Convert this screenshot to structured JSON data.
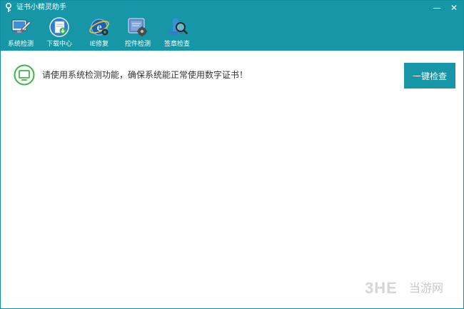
{
  "window": {
    "title": "证书小精灵助手",
    "minimize_glyph": "—",
    "close_glyph": "✕"
  },
  "toolbar": {
    "items": [
      {
        "label": "系统检测",
        "icon": "system-check-icon"
      },
      {
        "label": "下载中心",
        "icon": "download-center-icon"
      },
      {
        "label": "IE修复",
        "icon": "ie-repair-icon"
      },
      {
        "label": "控件检测",
        "icon": "control-check-icon"
      },
      {
        "label": "签章检查",
        "icon": "signature-check-icon"
      }
    ]
  },
  "main": {
    "notice": "请使用系统检测功能，确保系统能正常使用数字证书！",
    "check_button": "一键检查"
  },
  "watermark": {
    "logo": "3HE",
    "text": "当游网"
  },
  "colors": {
    "accent": "#1696a6",
    "notice_icon": "#3cb44a"
  }
}
